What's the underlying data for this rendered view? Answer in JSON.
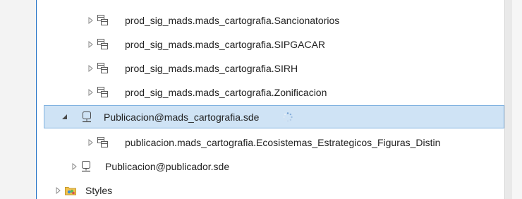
{
  "tree": {
    "rows": [
      {
        "label": "prod_sig_mads.mads_cartografia.Sancionatorios",
        "icon": "feature-dataset-icon",
        "expander": "collapsed"
      },
      {
        "label": "prod_sig_mads.mads_cartografia.SIPGACAR",
        "icon": "feature-dataset-icon",
        "expander": "collapsed"
      },
      {
        "label": "prod_sig_mads.mads_cartografia.SIRH",
        "icon": "feature-dataset-icon",
        "expander": "collapsed"
      },
      {
        "label": "prod_sig_mads.mads_cartografia.Zonificacion",
        "icon": "feature-dataset-icon",
        "expander": "collapsed"
      },
      {
        "label": "Publicacion@mads_cartografia.sde",
        "icon": "database-connection-icon",
        "expander": "expanded",
        "loading": true
      },
      {
        "label": "publicacion.mads_cartografia.Ecosistemas_Estrategicos_Figuras_Distin",
        "icon": "feature-dataset-icon",
        "expander": "collapsed"
      },
      {
        "label": "Publicacion@publicador.sde",
        "icon": "database-connection-icon",
        "expander": "collapsed"
      },
      {
        "label": "Styles",
        "icon": "styles-folder-icon",
        "expander": "collapsed"
      }
    ]
  },
  "colors": {
    "selection": "#cfe3f5",
    "selection_border": "#80b2e0",
    "accent": "#1f6fc5"
  }
}
